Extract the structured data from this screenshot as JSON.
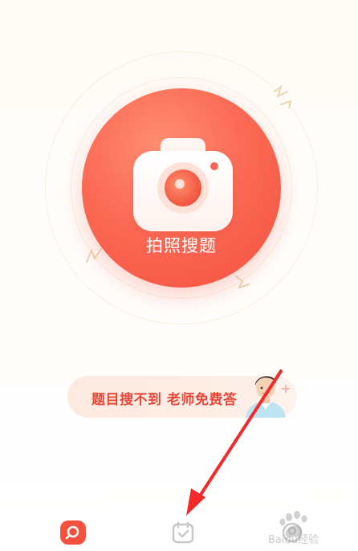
{
  "camera": {
    "label": "拍照搜题"
  },
  "banner": {
    "text": "题目搜不到 老师免费答"
  },
  "bottom_nav": {
    "items": [
      {
        "icon": "search-icon",
        "active": true
      },
      {
        "icon": "checkbox-icon",
        "active": false
      },
      {
        "icon": "profile-icon",
        "active": false
      }
    ]
  },
  "colors": {
    "accent": "#f6513f",
    "banner_text": "#e8473a",
    "inactive_icon": "#c8c8c8",
    "annotation_arrow": "#f22a2a"
  },
  "watermark": {
    "text": "Baidu经验"
  }
}
